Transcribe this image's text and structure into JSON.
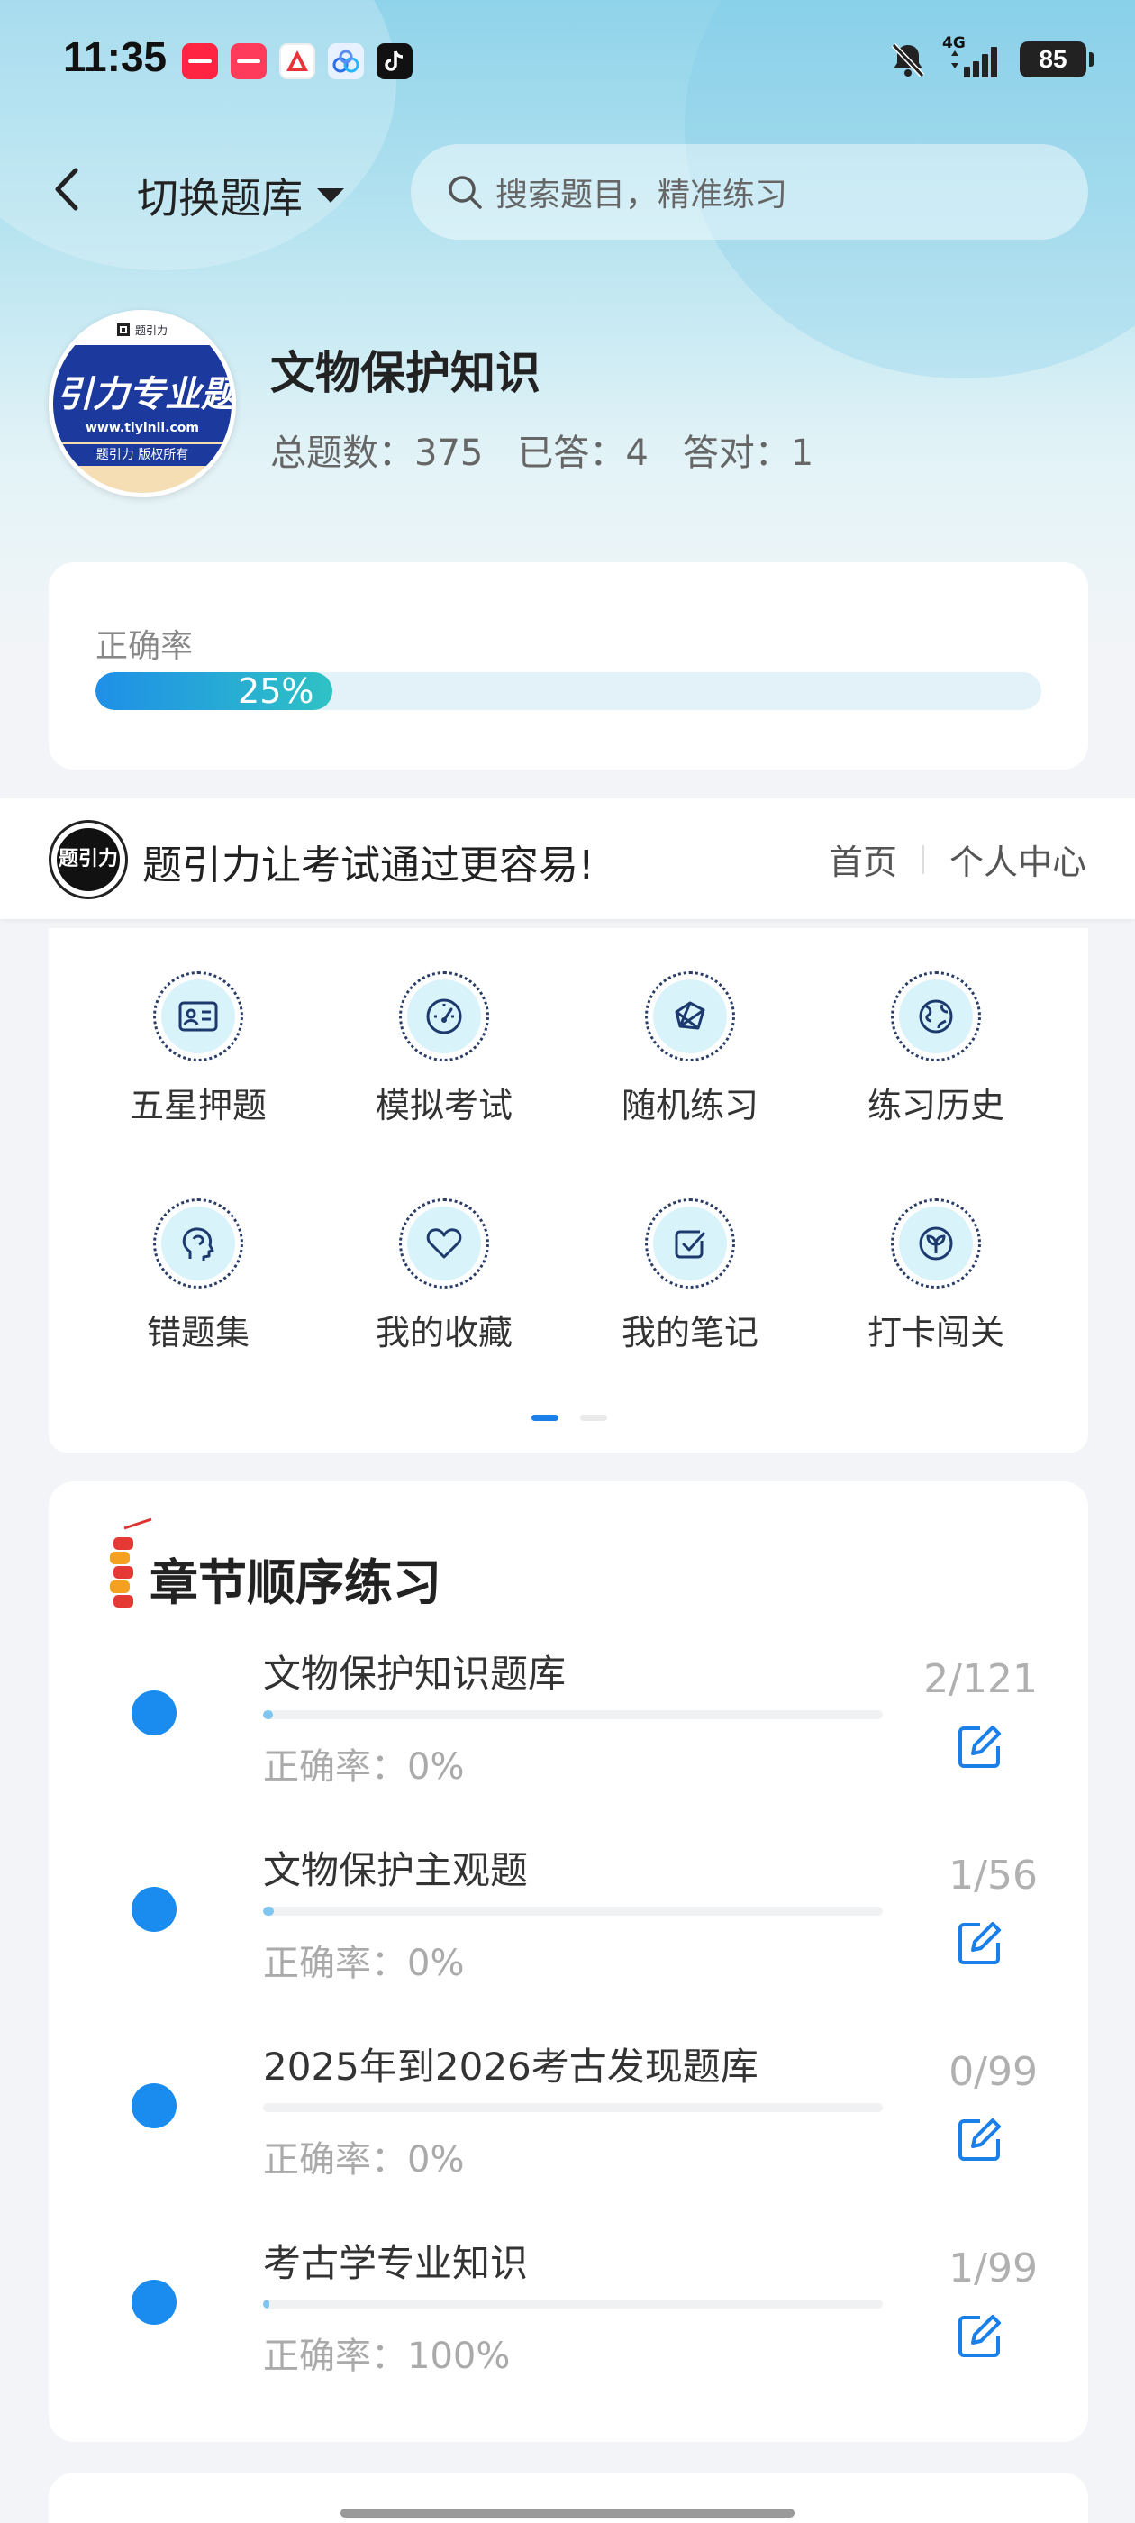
{
  "status_bar": {
    "time": "11:35",
    "notifications": [
      "xiaohongshu-icon",
      "xiaohongshu-icon",
      "acrobat-icon",
      "baidu-netdisk-icon",
      "tiktok-icon"
    ],
    "network": "4G",
    "battery": "85"
  },
  "header": {
    "switch_label": "切换题库",
    "search_placeholder": "搜索题目，精准练习"
  },
  "bank": {
    "title": "文物保护知识",
    "logo_text": "引力专业题",
    "logo_url": "www.tiyinli.com",
    "logo_copyright": "题引力 版权所有",
    "logo_brand": "题引力",
    "stats": {
      "total": "总题数：375",
      "answered": "已答：4",
      "correct": "答对：1"
    }
  },
  "accuracy": {
    "label": "正确率",
    "value_text": "25%",
    "value": 0.25
  },
  "banner": {
    "logo_text": "题引力",
    "slogan": "题引力让考试通过更容易!",
    "nav_home": "首页",
    "nav_personal": "个人中心"
  },
  "features": [
    {
      "label": "五星押题",
      "icon": "id-card-icon"
    },
    {
      "label": "模拟考试",
      "icon": "gauge-icon"
    },
    {
      "label": "随机练习",
      "icon": "network-icon"
    },
    {
      "label": "练习历史",
      "icon": "globe-icon"
    },
    {
      "label": "错题集",
      "icon": "head-icon"
    },
    {
      "label": "我的收藏",
      "icon": "heart-icon"
    },
    {
      "label": "我的笔记",
      "icon": "check-note-icon"
    },
    {
      "label": "打卡闯关",
      "icon": "leaf-badge-icon"
    }
  ],
  "pager": {
    "pages": 2,
    "active": 0
  },
  "chapters": {
    "title": "章节顺序练习",
    "items": [
      {
        "name": "文物保护知识题库",
        "accuracy": "正确率：0%",
        "count": "2/121",
        "progress": 0.0165
      },
      {
        "name": "文物保护主观题",
        "accuracy": "正确率：0%",
        "count": "1/56",
        "progress": 0.0179
      },
      {
        "name": "2025年到2026考古发现题库",
        "accuracy": "正确率：0%",
        "count": "0/99",
        "progress": 0.0
      },
      {
        "name": "考古学专业知识",
        "accuracy": "正确率：100%",
        "count": "1/99",
        "progress": 0.0101
      }
    ]
  },
  "colors": {
    "accent": "#1a8cf0",
    "progress_start": "#1f8fe8",
    "progress_end": "#2ec2c4"
  }
}
